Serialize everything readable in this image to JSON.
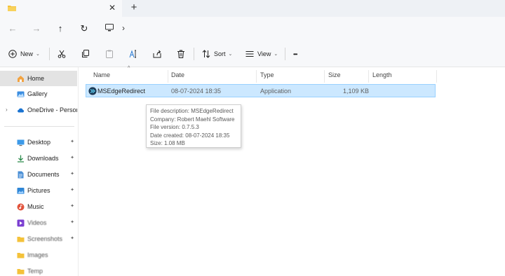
{
  "tabs": {
    "close_glyph": "✕",
    "new_tab_glyph": "+"
  },
  "nav": {
    "back_glyph": "←",
    "forward_glyph": "→",
    "up_glyph": "↑",
    "refresh_glyph": "↻",
    "chevron_glyph": "›"
  },
  "toolbar": {
    "new_label": "New",
    "sort_label": "Sort",
    "view_label": "View",
    "more_glyph": "•••",
    "caret_glyph": "⌄"
  },
  "sidebar": {
    "items": [
      {
        "label": "Home",
        "icon": "home-icon"
      },
      {
        "label": "Gallery",
        "icon": "gallery-icon"
      },
      {
        "label": "OneDrive - Persona",
        "icon": "cloud-icon"
      },
      {
        "label": "Desktop",
        "icon": "desktop-icon"
      },
      {
        "label": "Downloads",
        "icon": "download-icon"
      },
      {
        "label": "Documents",
        "icon": "document-icon"
      },
      {
        "label": "Pictures",
        "icon": "picture-icon"
      },
      {
        "label": "Music",
        "icon": "music-icon"
      },
      {
        "label": "Videos",
        "icon": "video-icon"
      },
      {
        "label": "Screenshots",
        "icon": "folder-icon"
      },
      {
        "label": "Images",
        "icon": "folder-icon"
      },
      {
        "label": "Temp",
        "icon": "folder-icon"
      }
    ],
    "pin_glyph": "📌",
    "expander_glyph": "›"
  },
  "columns": {
    "name": "Name",
    "date": "Date",
    "type": "Type",
    "size": "Size",
    "length": "Length",
    "sort_glyph": "^"
  },
  "file": {
    "name": "MSEdgeRedirect",
    "date": "08-07-2024 18:35",
    "type": "Application",
    "size": "1,109 KB",
    "length": ""
  },
  "tooltip": {
    "description": "File description: MSEdgeRedirect",
    "company": "Company: Robert Maehl Software",
    "version": "File version: 0.7.5.3",
    "created": "Date created: 08-07-2024 18:35",
    "size": "Size: 1.08 MB"
  },
  "colors": {
    "selection_bg": "#cce8ff",
    "selection_border": "#99d1ff",
    "folder_yellow": "#f4c23a",
    "accent_blue": "#2a7bd4"
  }
}
